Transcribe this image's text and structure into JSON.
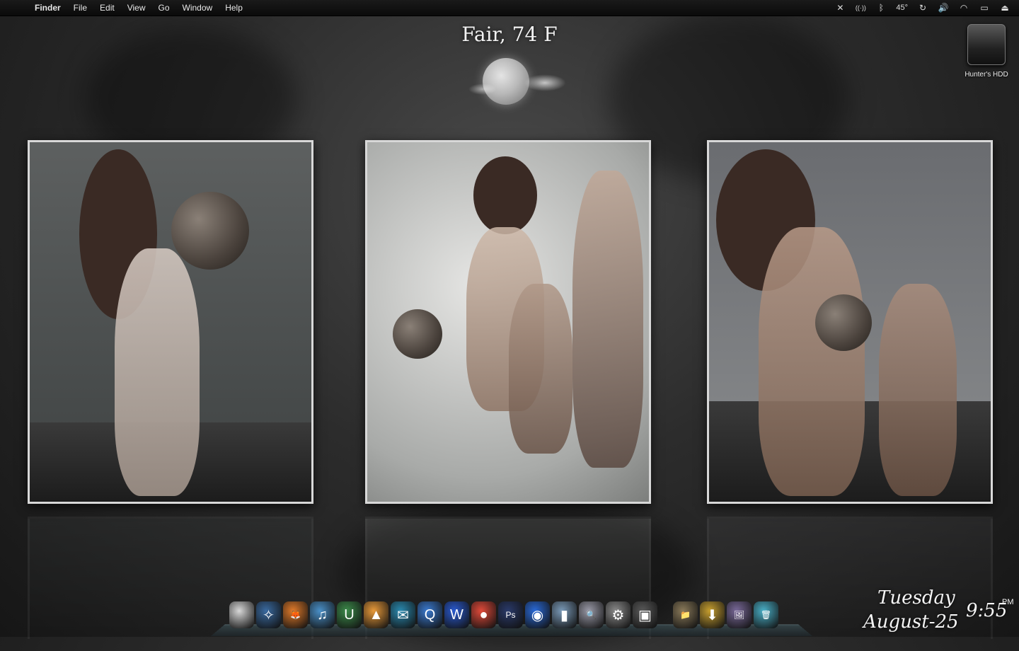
{
  "menubar": {
    "app": "Finder",
    "menus": [
      "File",
      "Edit",
      "View",
      "Go",
      "Window",
      "Help"
    ],
    "status": {
      "temperature": "45°",
      "icons": [
        "cross-app-icon",
        "antenna-icon",
        "bluetooth-icon",
        "temperature-readout",
        "time-machine-icon",
        "volume-icon",
        "wifi-icon",
        "battery-icon",
        "eject-icon"
      ]
    }
  },
  "weather": {
    "text": "Fair, 74 F",
    "icon": "moon-with-cloud-icon"
  },
  "desktop": {
    "hdd_label": "Hunter's HDD"
  },
  "photos": [
    {
      "name": "photo-soccer-left"
    },
    {
      "name": "photo-soccer-center"
    },
    {
      "name": "photo-soccer-right"
    }
  ],
  "dock": {
    "apps": [
      {
        "name": "finder-icon",
        "glyph": ""
      },
      {
        "name": "safari-icon",
        "glyph": "✧"
      },
      {
        "name": "firefox-icon",
        "glyph": "🦊"
      },
      {
        "name": "itunes-icon",
        "glyph": "♫"
      },
      {
        "name": "unreal-icon",
        "glyph": "U"
      },
      {
        "name": "vlc-icon",
        "glyph": "▲"
      },
      {
        "name": "mail-icon",
        "glyph": "✉"
      },
      {
        "name": "quicktime-icon",
        "glyph": "Q"
      },
      {
        "name": "wordpress-icon",
        "glyph": "W"
      },
      {
        "name": "lollipop-icon",
        "glyph": "●"
      },
      {
        "name": "photoshop-icon",
        "glyph": "Ps"
      },
      {
        "name": "globe-icon",
        "glyph": "◉"
      },
      {
        "name": "usb-drive-icon",
        "glyph": "▮"
      },
      {
        "name": "magnifier-icon",
        "glyph": "🔍"
      },
      {
        "name": "system-preferences-icon",
        "glyph": "⚙"
      },
      {
        "name": "preview-icon",
        "glyph": "▣"
      }
    ],
    "stacks": [
      {
        "name": "applications-folder-icon",
        "glyph": "📁"
      },
      {
        "name": "downloads-folder-icon",
        "glyph": "⬇"
      },
      {
        "name": "pictures-folder-icon",
        "glyph": "🖼"
      },
      {
        "name": "trash-icon",
        "glyph": "🗑"
      }
    ]
  },
  "clock": {
    "day": "Tuesday",
    "date": "August-25",
    "time": "9:55",
    "ampm": "PM"
  },
  "colors": {
    "menubar_bg": "#0a0a0a",
    "wallpaper": "#2c2c2c",
    "photo_border": "#d8d8d8"
  }
}
